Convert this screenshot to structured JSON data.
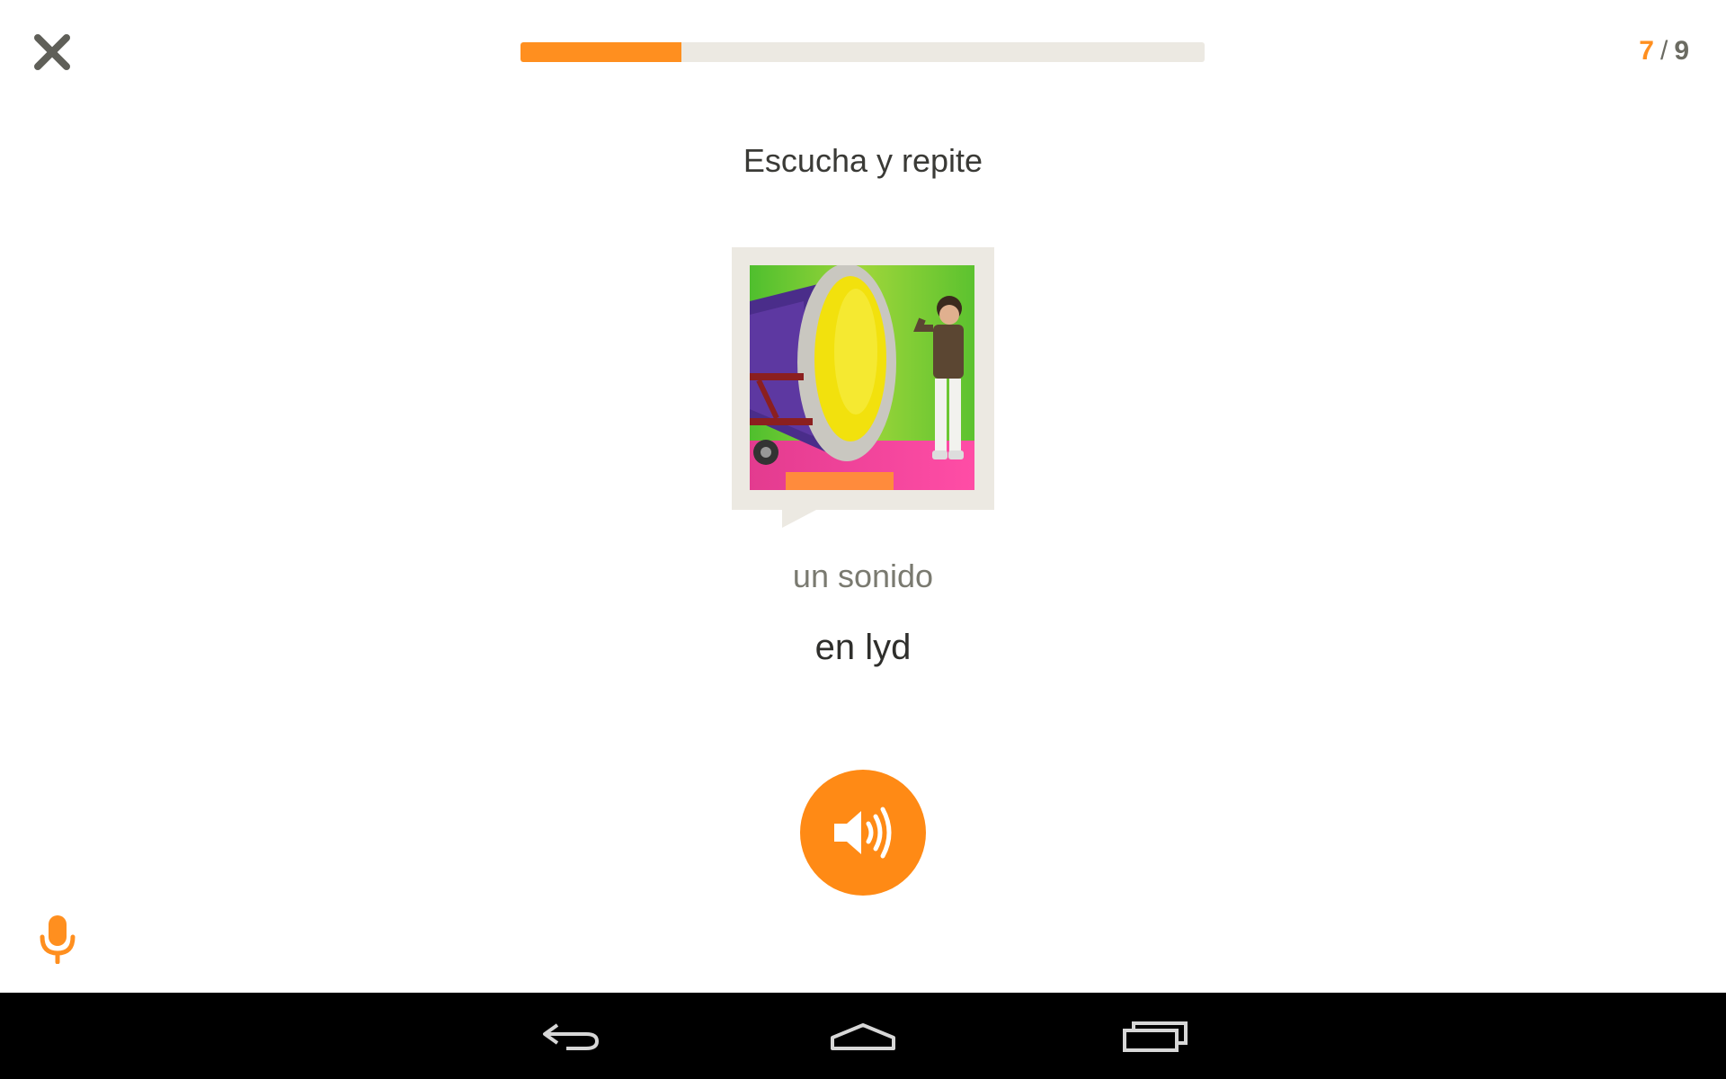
{
  "header": {
    "close_icon": "close-icon",
    "progress": {
      "current": 7,
      "total": 9,
      "fraction": 0.235
    },
    "counter": {
      "current": "7",
      "separator": "/",
      "total": "9"
    }
  },
  "exercise": {
    "instruction": "Escucha y repite",
    "image_icon": "photo-child-beside-large-tube",
    "phrase": "un sonido",
    "translation": "en lyd",
    "speaker_icon": "speaker-icon"
  },
  "footer": {
    "mic_icon": "microphone-icon"
  },
  "system_nav": {
    "back_icon": "back-icon",
    "home_icon": "home-icon",
    "recents_icon": "recents-icon"
  },
  "colors": {
    "accent": "#ff8f1f",
    "track": "#ece9e2",
    "text_dark": "#3a3a36",
    "text_muted": "#7a7a70"
  }
}
